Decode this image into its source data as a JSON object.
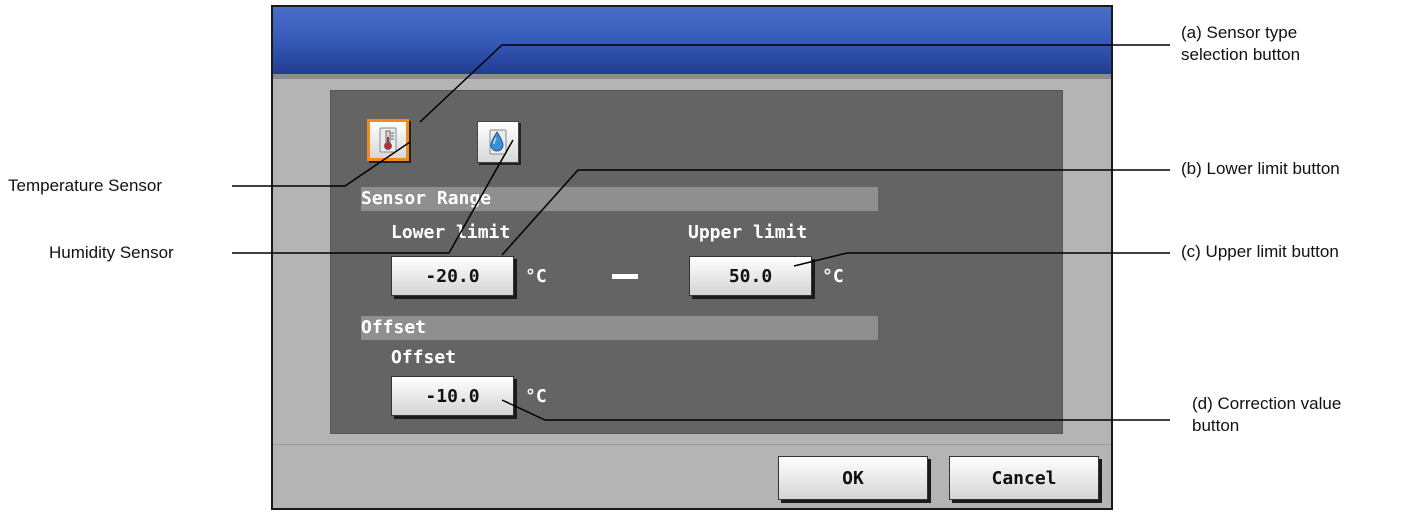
{
  "sensor_types": {
    "temperature": {
      "icon": "thermometer-icon",
      "selected": true
    },
    "humidity": {
      "icon": "water-drop-icon",
      "selected": false
    }
  },
  "sensor_range": {
    "title": "Sensor Range",
    "lower_label": "Lower limit",
    "upper_label": "Upper limit",
    "lower_value": "-20.0",
    "upper_value": "50.0",
    "unit": "°C"
  },
  "offset": {
    "title": "Offset",
    "label": "Offset",
    "value": "-10.0",
    "unit": "°C"
  },
  "buttons": {
    "ok": "OK",
    "cancel": "Cancel"
  },
  "callouts": {
    "sensor_type_line1": "(a) Sensor type",
    "sensor_type_line2": "selection button",
    "lower_limit": "(b) Lower limit button",
    "upper_limit": "(c) Upper limit button",
    "correction_line1": "(d) Correction value",
    "correction_line2": "button",
    "temperature_sensor": "Temperature Sensor",
    "humidity_sensor": "Humidity Sensor"
  },
  "colors": {
    "title_bar": "#365ab8",
    "panel": "#646464",
    "selected_border": "#f28b1b"
  }
}
